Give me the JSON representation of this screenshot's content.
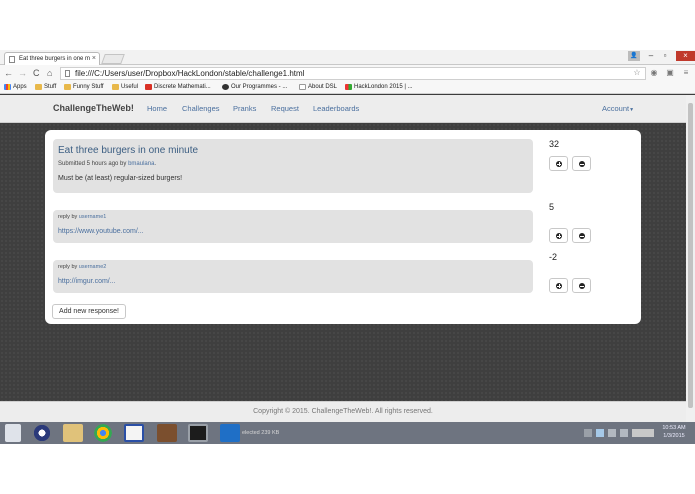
{
  "browser": {
    "tab_title": "Eat three burgers in one m",
    "url": "file:///C:/Users/user/Dropbox/HackLondon/stable/challenge1.html",
    "bookmarks": [
      "Apps",
      "Stuff",
      "Funny Stuff",
      "Useful",
      "Discrete Mathemati...",
      "Our Programmes - ...",
      "About DSL",
      "HackLondon 2015 | ..."
    ]
  },
  "site": {
    "brand": "ChallengeTheWeb!",
    "nav": [
      "Home",
      "Challenges",
      "Pranks",
      "Request",
      "Leaderboards"
    ],
    "account": "Account"
  },
  "challenge": {
    "title": "Eat three burgers in one minute",
    "meta_prefix": "Submitted 5 hours ago by",
    "author": "bmaulana",
    "meta_suffix": ".",
    "body": "Must be (at least) regular-sized burgers!",
    "score": "32"
  },
  "replies": [
    {
      "prefix": "reply by",
      "user": "username1",
      "link": "https://www.youtube.com/...",
      "score": "5"
    },
    {
      "prefix": "reply by",
      "user": "username2",
      "link": "http://imgur.com/...",
      "score": "-2"
    }
  ],
  "add_response_label": "Add new response!",
  "footer": "Copyright © 2015. ChallengeTheWeb!. All rights reserved.",
  "taskbar": {
    "status_text": "elected  239 KB",
    "clock_time": "10:53 AM",
    "clock_date": "1/3/2015"
  },
  "colors": {
    "link": "#4a6f9e",
    "card_bg": "#ffffff",
    "post_bg": "#e2e2e2",
    "page_bg": "#3f3f3f"
  }
}
